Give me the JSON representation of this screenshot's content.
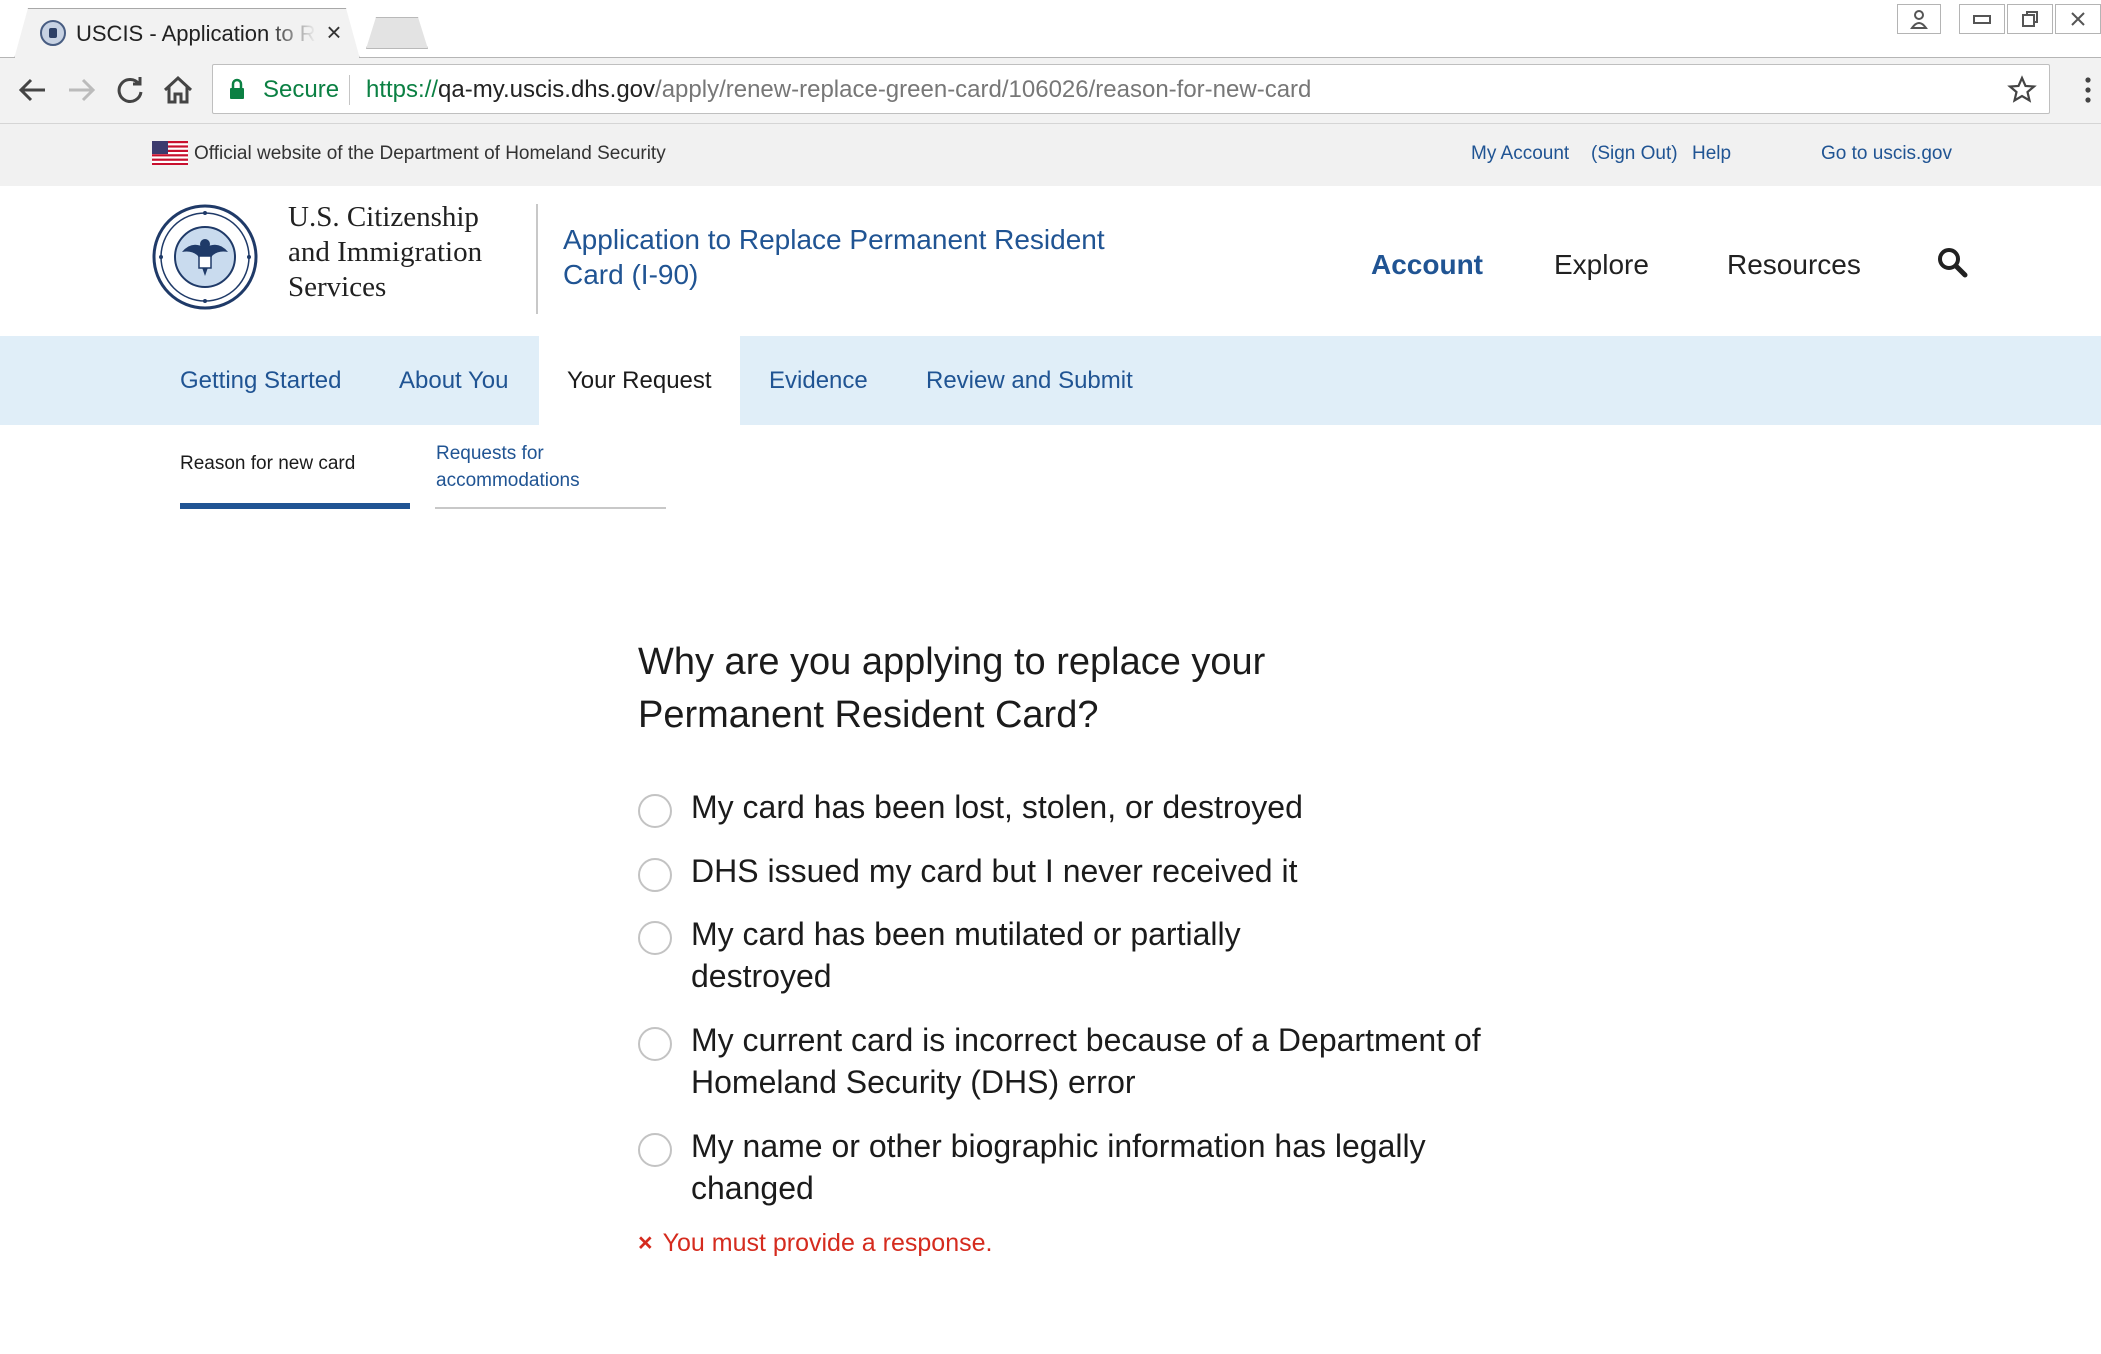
{
  "browser": {
    "tab_title": "USCIS - Application to Re",
    "tab_close": "×",
    "secure_label": "Secure",
    "url_scheme": "https://",
    "url_host": "qa-my.uscis.dhs.gov",
    "url_path": "/apply/renew-replace-green-card/106026/reason-for-new-card"
  },
  "gov_banner": {
    "official_text": "Official website of the Department of Homeland Security",
    "my_account": "My Account",
    "sign_out": "(Sign Out)",
    "help": "Help",
    "go_to": "Go to uscis.gov"
  },
  "header": {
    "agency_line1": "U.S. Citizenship",
    "agency_line2": "and Immigration",
    "agency_line3": "Services",
    "app_title": "Application to Replace Permanent Resident Card (I-90)",
    "nav": {
      "account": "Account",
      "explore": "Explore",
      "resources": "Resources"
    }
  },
  "steps": [
    "Getting Started",
    "About You",
    "Your Request",
    "Evidence",
    "Review and Submit"
  ],
  "subnav": {
    "current": "Reason for new card",
    "next_line1": "Requests for",
    "next_line2": "accommodations"
  },
  "question": "Why are you applying to replace your Permanent Resident Card?",
  "options": [
    "My card has been lost, stolen, or destroyed",
    "DHS issued my card but I never received it",
    "My card has been mutilated or partially destroyed",
    "My current card is incorrect because of a Department of Homeland Security (DHS) error",
    "My name or other biographic information has legally changed"
  ],
  "error": {
    "icon": "×",
    "message": "You must provide a response."
  },
  "colors": {
    "link_blue": "#205493",
    "step_bar": "#e0eef8",
    "error_red": "#d52b1e",
    "secure_green": "#0b8043"
  }
}
